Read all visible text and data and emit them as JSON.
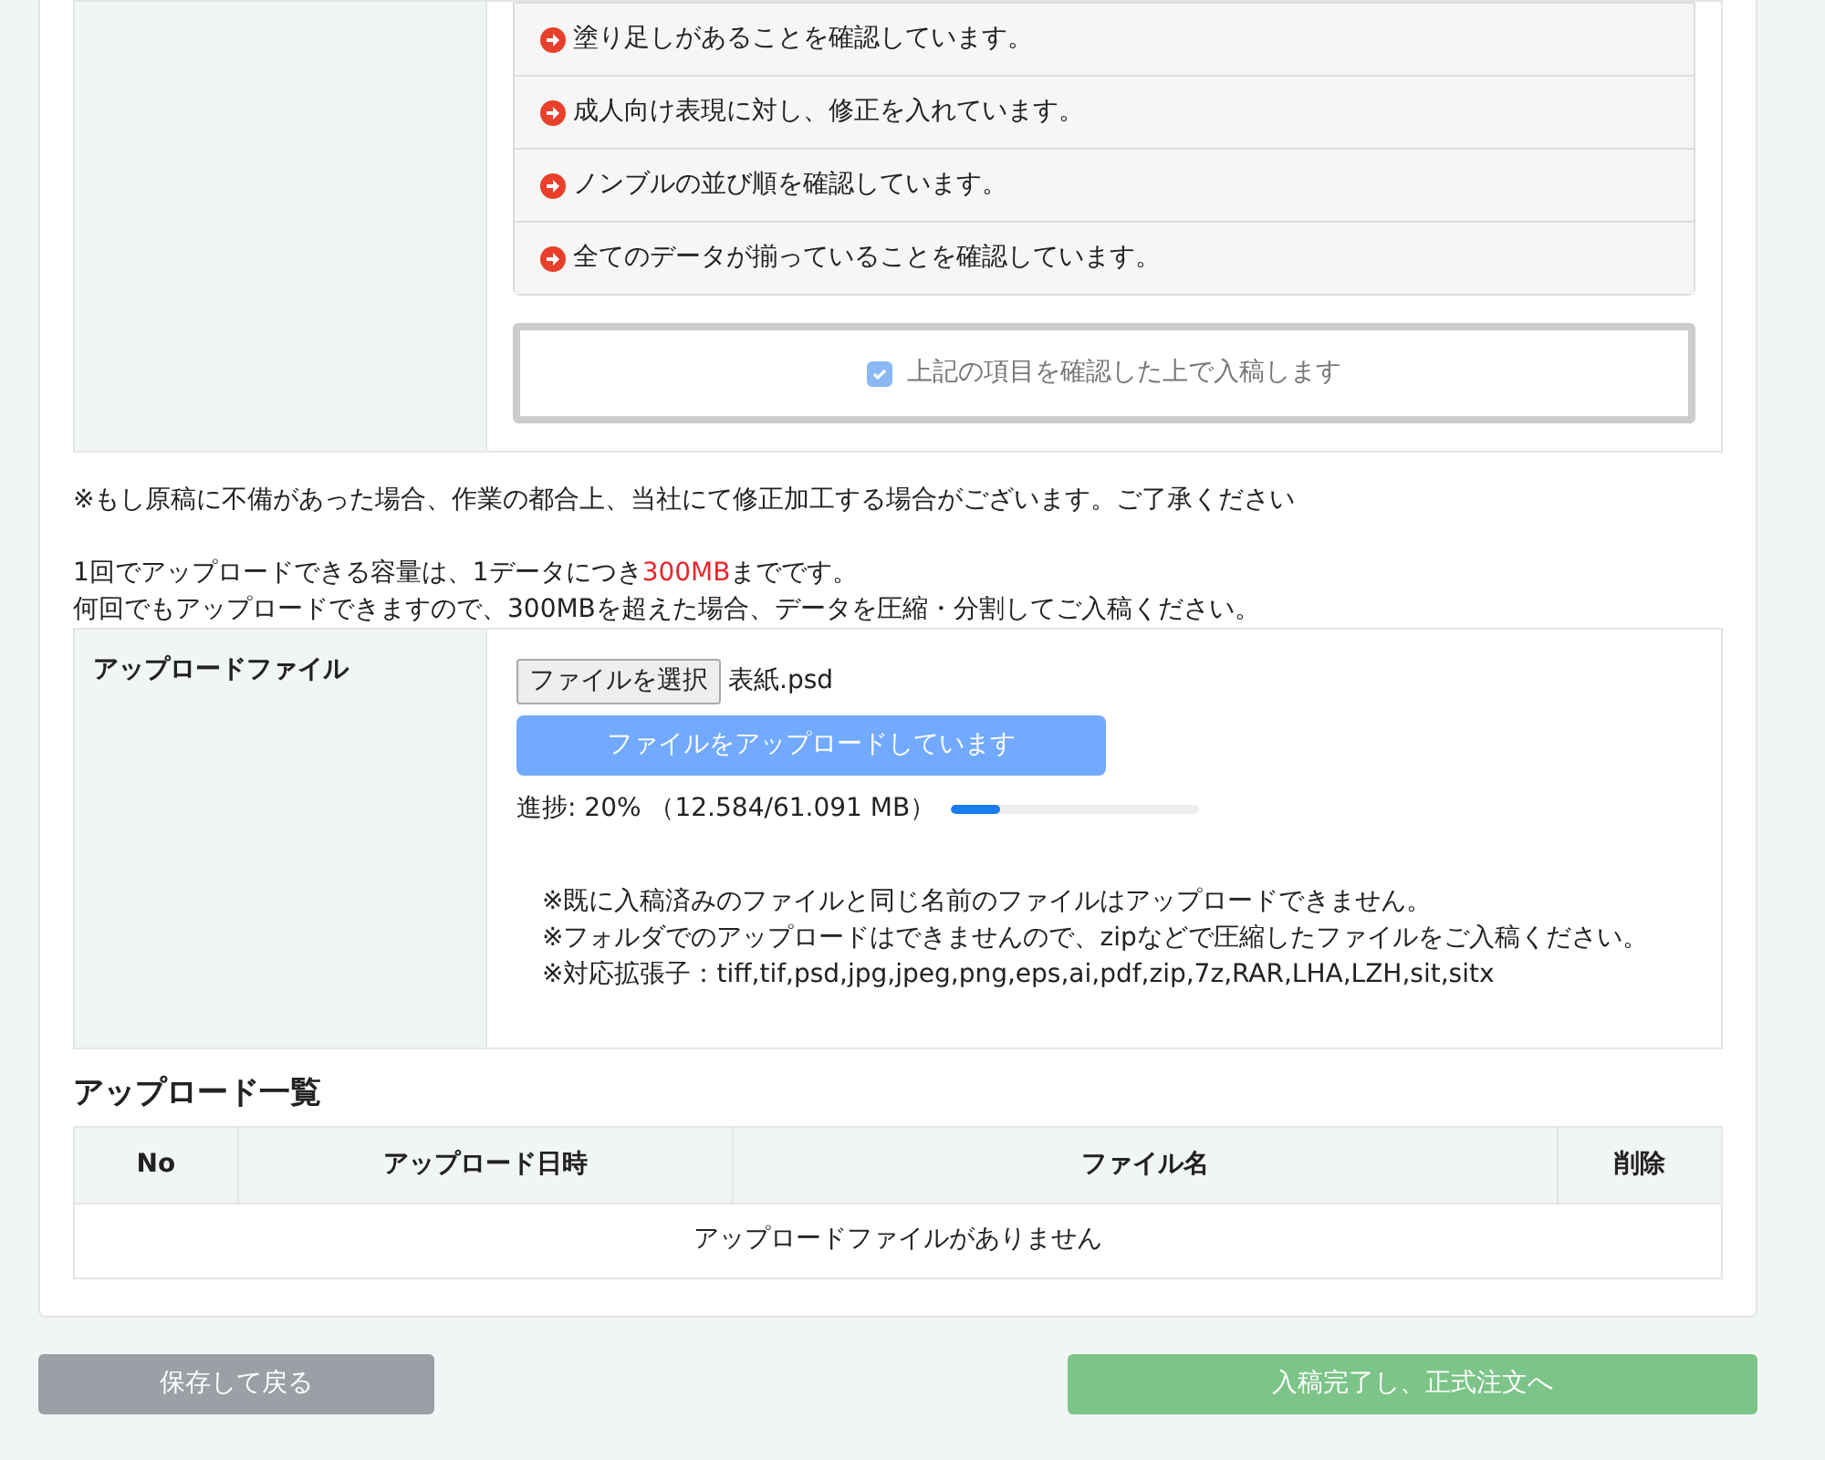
{
  "checklist": {
    "items": [
      {
        "text": "塗り足しがあることを確認しています。"
      },
      {
        "text": "成人向け表現に対し、修正を入れています。"
      },
      {
        "text": "ノンブルの並び順を確認しています。"
      },
      {
        "text": "全てのデータが揃っていることを確認しています。"
      }
    ],
    "confirm": {
      "label": "上記の項目を確認した上で入稿します",
      "checked": true,
      "disabled": true
    }
  },
  "notes": [
    "※もし原稿に不備があった場合、作業の都合上、当社にて修正加工する場合がございます。ご了承ください",
    "1回でアップロードできる容量は、1データにつき**300MB**までです。",
    "何回でもアップロードできますので、300MBを超えた場合、データを圧縮・分割してご入稿ください。"
  ],
  "upload": {
    "label": "アップロードファイル",
    "choose_button": "ファイルを選択",
    "file_name": "表紙.psd",
    "upload_button": {
      "label": "ファイルをアップロードしています",
      "disabled": true
    },
    "progress_text": "進捗: 20% （12.584/61.091 MB）",
    "level": 0.2,
    "hints": [
      "※既に入稿済みのファイルと同じ名前のファイルはアップロードできません。",
      "※フォルダでのアップロードはできませんので、zipなどで圧縮したファイルをご入稿ください。",
      "※対応拡張子：tiff,tif,psd,jpg,jpeg,png,eps,ai,pdf,zip,7z,RAR,LHA,LZH,sit,sitx"
    ]
  },
  "upload_list": {
    "title": "アップロード一覧",
    "columns": [
      "No",
      "アップロード日時",
      "ファイル名",
      "削除"
    ],
    "empty_text": "アップロードファイルがありません"
  },
  "buttons": [
    {
      "label": "保存して戻る",
      "kind": "secondary",
      "disabled": true
    },
    {
      "label": "入稿完了し、正式注文へ",
      "kind": "success",
      "disabled": true
    }
  ]
}
